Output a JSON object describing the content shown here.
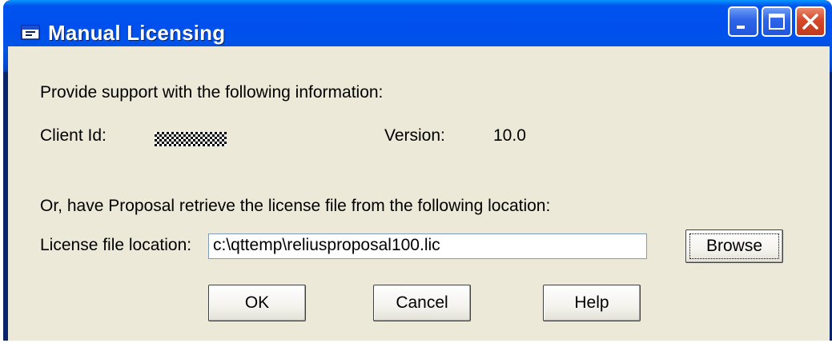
{
  "window": {
    "title": "Manual Licensing",
    "controls": {
      "minimize": "minimize-icon",
      "maximize": "maximize-icon",
      "close": "close-icon"
    }
  },
  "dialog": {
    "instruction": "Provide support with the following information:",
    "client_id_label": "Client Id:",
    "version_label": "Version:",
    "version_value": "10.0",
    "retrieve_instruction": "Or, have Proposal retrieve the license file from the following location:",
    "license_location_label": "License file location:",
    "license_location_value": "c:\\qttemp\\reliusproposal100.lic"
  },
  "buttons": {
    "browse": "Browse",
    "ok": "OK",
    "cancel": "Cancel",
    "help": "Help"
  },
  "colors": {
    "titlebar": "#0054e3",
    "dialog_bg": "#ece9d8",
    "close_button": "#d4472a"
  }
}
